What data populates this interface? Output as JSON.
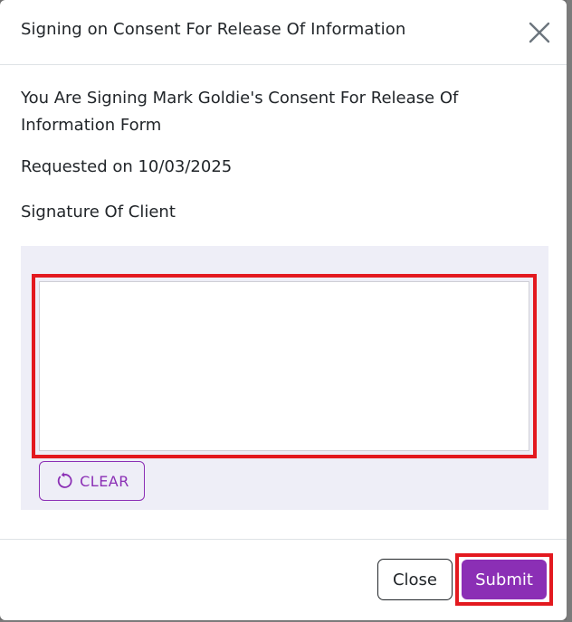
{
  "dialog": {
    "title": "Signing on Consent For Release Of Information",
    "close_icon": "close-icon"
  },
  "body": {
    "intro_text": "You Are Signing Mark Goldie's Consent For Release Of Information Form",
    "requested_text": "Requested on 10/03/2025",
    "signature_label": "Signature Of Client",
    "clear_label": "CLEAR",
    "clear_icon": "refresh-icon"
  },
  "footer": {
    "close_label": "Close",
    "submit_label": "Submit"
  },
  "colors": {
    "accent": "#8b2fb5",
    "highlight": "#e3191f",
    "signature_panel": "#eeeef7"
  }
}
